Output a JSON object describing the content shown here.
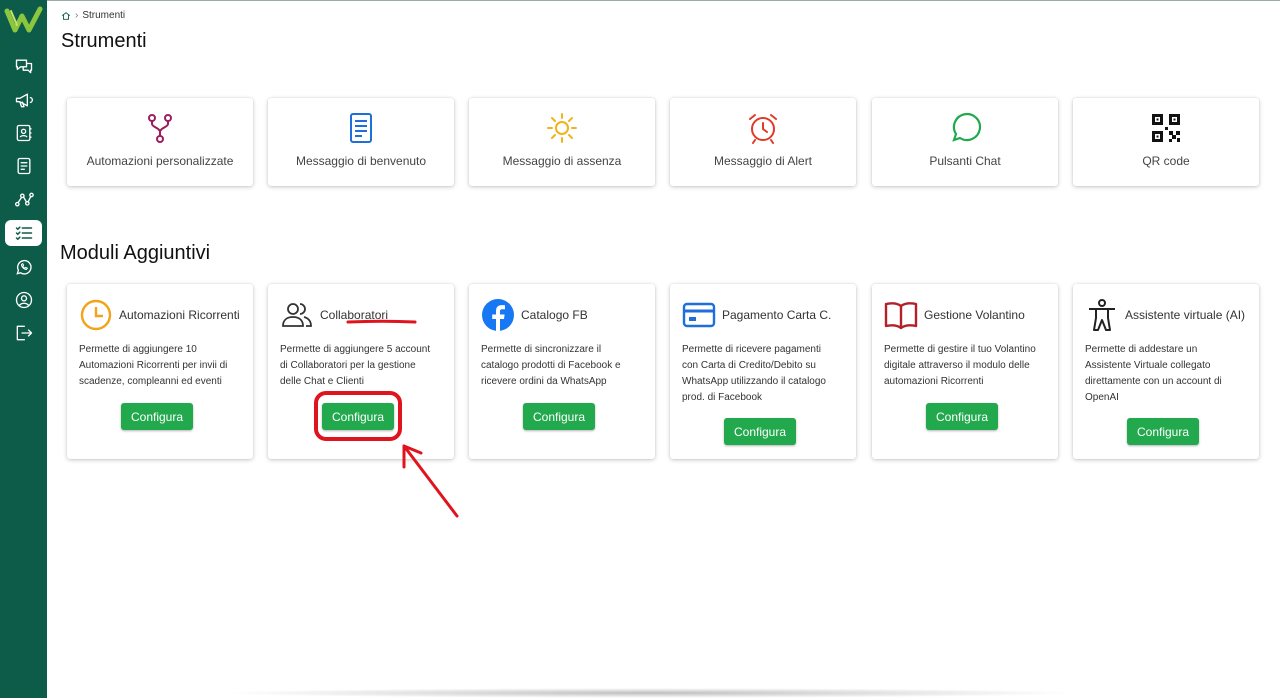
{
  "app": {
    "logo_text": "W"
  },
  "sidebar": {
    "items": [
      {
        "icon": "chat-icon"
      },
      {
        "icon": "megaphone-icon"
      },
      {
        "icon": "contacts-icon"
      },
      {
        "icon": "document-icon"
      },
      {
        "icon": "flow-icon"
      },
      {
        "icon": "checklist-icon",
        "active": true
      },
      {
        "icon": "whatsapp-icon"
      },
      {
        "icon": "account-icon"
      },
      {
        "icon": "logout-icon"
      }
    ]
  },
  "breadcrumb": {
    "current": "Strumenti"
  },
  "page": {
    "title": "Strumenti",
    "section_title": "Moduli Aggiuntivi"
  },
  "tools": [
    {
      "label": "Automazioni personalizzate",
      "icon": "fork-icon",
      "color": "#9c1d5e"
    },
    {
      "label": "Messaggio di benvenuto",
      "icon": "document-icon",
      "color": "#1e6fd9"
    },
    {
      "label": "Messaggio di assenza",
      "icon": "sun-icon",
      "color": "#f2b21b"
    },
    {
      "label": "Messaggio di Alert",
      "icon": "alarm-icon",
      "color": "#e03b2a"
    },
    {
      "label": "Pulsanti Chat",
      "icon": "chat-bubble-icon",
      "color": "#22a94e"
    },
    {
      "label": "QR code",
      "icon": "qr-code-icon",
      "color": "#111111"
    }
  ],
  "modules": [
    {
      "title": "Automazioni Ricorrenti",
      "icon": "clock-icon",
      "color": "#f2a31b",
      "desc": [
        "Permette di aggiungere 10",
        "Automazioni Ricorrenti per invii di",
        "scadenze, compleanni ed eventi"
      ],
      "button": "Configura"
    },
    {
      "title": "Collaboratori",
      "icon": "users-icon",
      "color": "#333333",
      "desc": [
        "Permette di aggiungere 5 account",
        "di Collaboratori per la gestione",
        "delle Chat e Clienti"
      ],
      "button": "Configura"
    },
    {
      "title": "Catalogo FB",
      "icon": "facebook-icon",
      "color": "#1877f2",
      "desc": [
        "Permette di sincronizzare il",
        "catalogo prodotti di Facebook e",
        "ricevere ordini da WhatsApp"
      ],
      "button": "Configura"
    },
    {
      "title": "Pagamento Carta C.",
      "icon": "credit-card-icon",
      "color": "#1e6fd9",
      "desc": [
        "Permette di ricevere pagamenti",
        "con Carta di Credito/Debito su",
        "WhatsApp utilizzando il catalogo",
        "prod. di Facebook"
      ],
      "button": "Configura"
    },
    {
      "title": "Gestione Volantino",
      "icon": "book-icon",
      "color": "#b3202a",
      "desc": [
        "Permette di gestire il tuo Volantino",
        "digitale attraverso il modulo delle",
        "automazioni Ricorrenti"
      ],
      "button": "Configura"
    },
    {
      "title": "Assistente virtuale (AI)",
      "icon": "person-icon",
      "color": "#222222",
      "desc": [
        "Permette di addestare un",
        "Assistente Virtuale collegato",
        "direttamente con un account di",
        "OpenAI"
      ],
      "button": "Configura"
    }
  ],
  "colors": {
    "sidebar": "#0d5c4a",
    "button": "#22a94e",
    "annotation": "#e0141e"
  }
}
